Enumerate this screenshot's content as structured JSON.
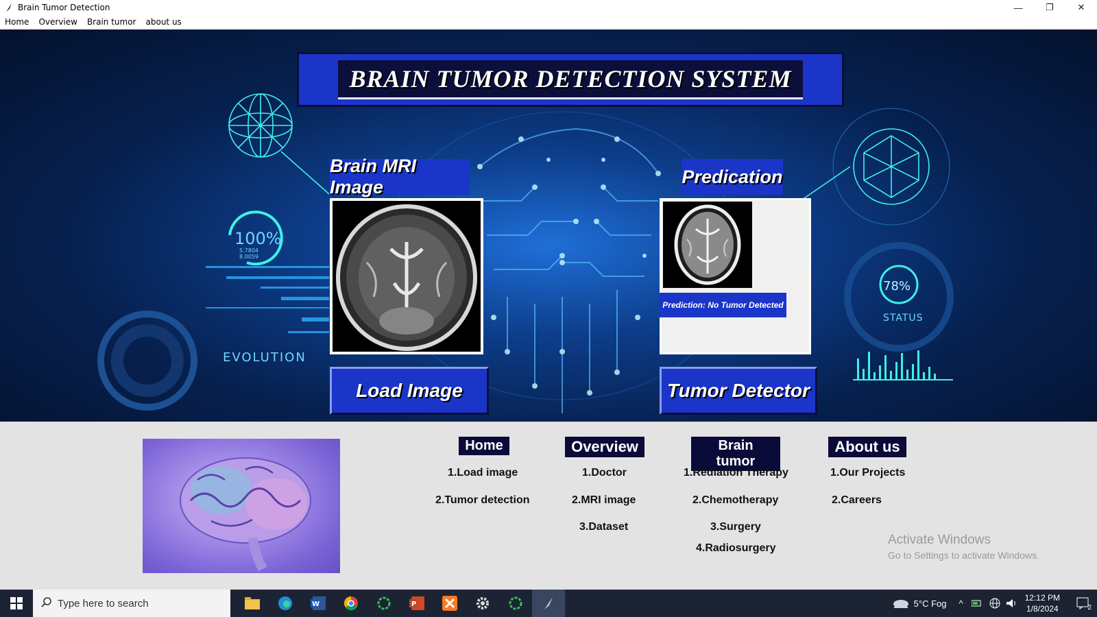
{
  "window": {
    "title": "Brain Tumor Detection",
    "minimize": "—",
    "maximize": "❐",
    "close": "✕"
  },
  "menu": [
    "Home",
    "Overview",
    "Brain tumor",
    "about us"
  ],
  "banner": {
    "title": "BRAIN TUMOR DETECTION SYSTEM",
    "mri_label": "Brain MRI Image",
    "pred_label": "Predication",
    "prediction_text": "Prediction: No Tumor Detected",
    "load_button": "Load Image",
    "detect_button": "Tumor Detector",
    "hud": {
      "percent": "100%",
      "small1": "5.7804",
      "small2": "8.0059",
      "evolution": "EVOLUTION",
      "status_pct": "78%",
      "status": "STATUS"
    }
  },
  "footer": {
    "columns": [
      {
        "head": "Home",
        "items": [
          "1.Load image",
          "2.Tumor detection"
        ]
      },
      {
        "head": "Overview",
        "items": [
          "1.Doctor",
          "2.MRI image",
          "3.Dataset"
        ]
      },
      {
        "head": "Brain tumor",
        "items": [
          "1.Rediation Therapy",
          "2.Chemotherapy",
          "3.Surgery",
          "4.Radiosurgery"
        ]
      },
      {
        "head": "About us",
        "items": [
          "1.Our Projects",
          "2.Careers"
        ]
      }
    ],
    "watermark_title": "Activate Windows",
    "watermark_sub": "Go to Settings to activate Windows."
  },
  "taskbar": {
    "search_placeholder": "Type here to search",
    "weather": "5°C  Fog",
    "time": "12:12 PM",
    "date": "1/8/2024",
    "notifications": "2"
  }
}
